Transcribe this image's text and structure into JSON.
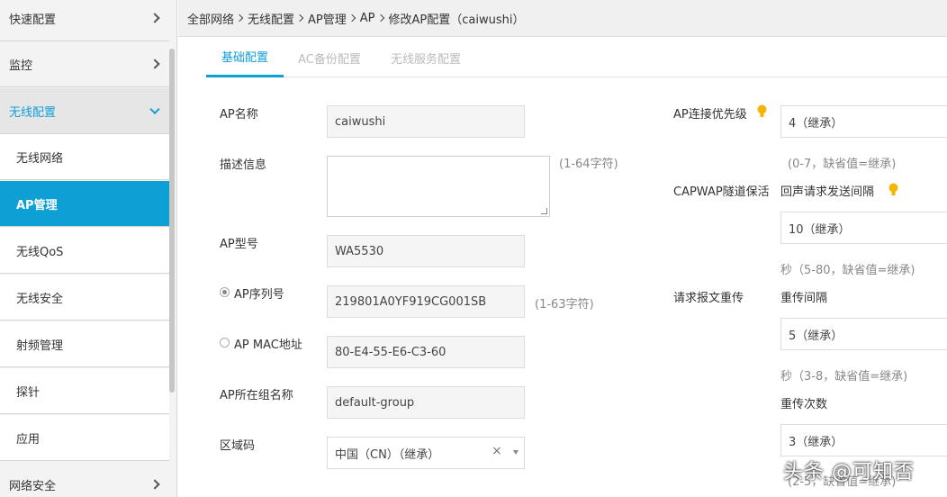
{
  "sidebar": {
    "items": [
      {
        "label": "快速配置"
      },
      {
        "label": "监控"
      },
      {
        "label": "无线配置"
      },
      {
        "label": "无线网络"
      },
      {
        "label": "AP管理"
      },
      {
        "label": "无线QoS"
      },
      {
        "label": "无线安全"
      },
      {
        "label": "射频管理"
      },
      {
        "label": "探针"
      },
      {
        "label": "应用"
      },
      {
        "label": "网络安全"
      }
    ]
  },
  "breadcrumb": [
    "全部网络",
    "无线配置",
    "AP管理",
    "AP",
    "修改AP配置（caiwushi）"
  ],
  "tabs": [
    {
      "label": "基础配置"
    },
    {
      "label": "AC备份配置"
    },
    {
      "label": "无线服务配置"
    }
  ],
  "form": {
    "ap_name": {
      "label": "AP名称",
      "value": "caiwushi"
    },
    "description": {
      "label": "描述信息",
      "hint": "(1-64字符)"
    },
    "ap_model": {
      "label": "AP型号",
      "value": "WA5530"
    },
    "ap_serial": {
      "label": "AP序列号",
      "value": "219801A0YF919CG001SB",
      "hint": "(1-63字符)"
    },
    "ap_mac": {
      "label": "AP MAC地址",
      "value": "80-E4-55-E6-C3-60"
    },
    "ap_group": {
      "label": "AP所在组名称",
      "value": "default-group"
    },
    "region": {
      "label": "区域码",
      "value": "中国（CN）（继承）"
    }
  },
  "right": {
    "priority": {
      "label": "AP连接优先级",
      "value": "4（继承）",
      "hint": "(0-7，缺省值=继承)"
    },
    "capwap": {
      "label": "CAPWAP隧道保活",
      "sublabel": "回声请求发送间隔",
      "value": "10（继承）",
      "hint": "秒（5-80，缺省值=继承)"
    },
    "retrans": {
      "label": "请求报文重传",
      "interval_label": "重传间隔",
      "interval_value": "5（继承）",
      "interval_hint": "秒（3-8，缺省值=继承)",
      "count_label": "重传次数",
      "count_value": "3（继承）",
      "count_hint": "(2-5，缺省值=继承)"
    }
  },
  "watermark": "头条 @可知否",
  "colors": {
    "accent": "#0e9fd5",
    "bulb": "#f4b400"
  }
}
